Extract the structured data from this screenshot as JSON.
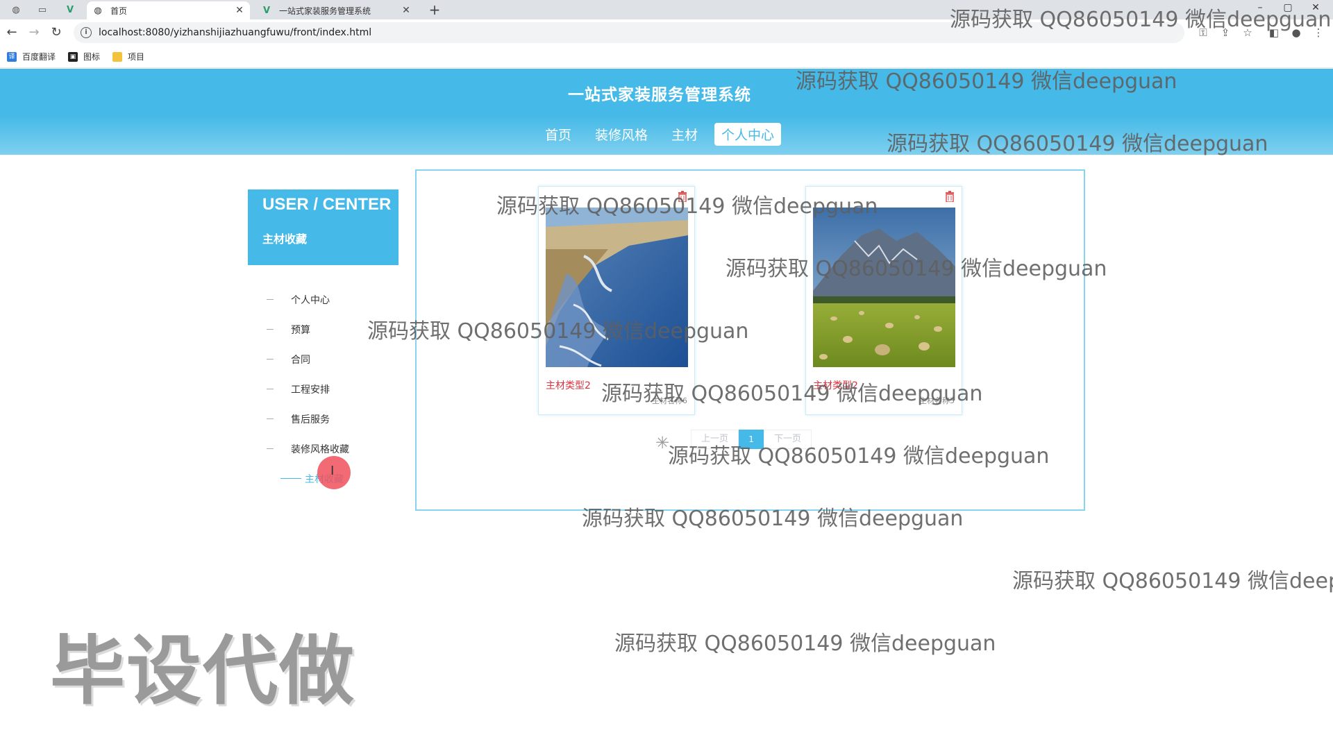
{
  "browser": {
    "tabs": [
      {
        "title": "首页",
        "active": true
      },
      {
        "title": "一站式家装服务管理系统",
        "active": false
      }
    ],
    "url": "localhost:8080/yizhanshijiazhuangfuwu/front/index.html",
    "bookmarks": [
      "百度翻译",
      "图标",
      "项目"
    ]
  },
  "site": {
    "title": "一站式家装服务管理系统",
    "nav": [
      "首页",
      "装修风格",
      "主材",
      "个人中心"
    ],
    "active_nav": "个人中心"
  },
  "sidebar": {
    "box_title": "USER / CENTER",
    "box_subtitle": "主材收藏",
    "menu": [
      "个人中心",
      "预算",
      "合同",
      "工程安排",
      "售后服务",
      "装修风格收藏",
      "主材收藏"
    ],
    "active_item": "主材收藏"
  },
  "favorites": [
    {
      "type": "主材类型2",
      "name": "主材名称6",
      "image": "coastline-landscape"
    },
    {
      "type": "主材类型2",
      "name": "主材名称5",
      "image": "mountain-hayfield-landscape"
    }
  ],
  "pagination": {
    "prev": "上一页",
    "current": "1",
    "next": "下一页"
  },
  "watermark": {
    "text": "源码获取 QQ86050149 微信deepguan",
    "text_cut": "源码获取 QQ86050149 微信deep",
    "big": "毕设代做"
  },
  "colors": {
    "accent": "#45b9e7",
    "type_red": "#d9333f"
  }
}
